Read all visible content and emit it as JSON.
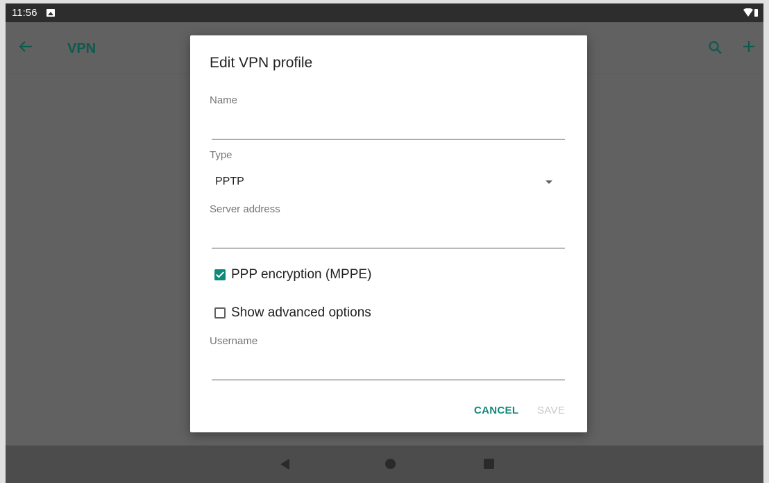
{
  "status_bar": {
    "time": "11:56"
  },
  "app_bar": {
    "title": "VPN",
    "back_icon": "arrow-left-icon",
    "search_icon": "search-icon",
    "add_icon": "plus-icon"
  },
  "dialog": {
    "title": "Edit VPN profile",
    "fields": {
      "name": {
        "label": "Name",
        "value": ""
      },
      "type": {
        "label": "Type",
        "value": "PPTP"
      },
      "server": {
        "label": "Server address",
        "value": ""
      },
      "username": {
        "label": "Username",
        "value": ""
      }
    },
    "checkboxes": {
      "mppe": {
        "label": "PPP encryption (MPPE)",
        "checked": true
      },
      "advanced": {
        "label": "Show advanced options",
        "checked": false
      }
    },
    "buttons": {
      "cancel": "CANCEL",
      "save": "SAVE"
    }
  },
  "colors": {
    "accent": "#0d8a79",
    "accent_dimmed": "#0d5a4e",
    "scrim": "#616161"
  }
}
